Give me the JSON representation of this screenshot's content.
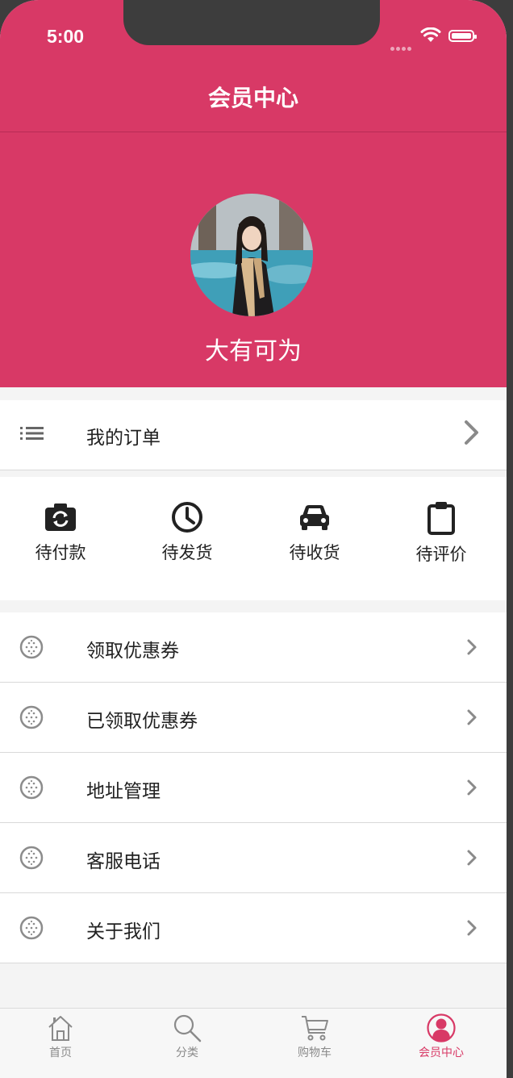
{
  "status_bar": {
    "time": "5:00"
  },
  "nav": {
    "title": "会员中心"
  },
  "profile": {
    "username": "大有可为"
  },
  "orders": {
    "label": "我的订单"
  },
  "order_statuses": [
    {
      "label": "待付款",
      "icon": "camera-icon"
    },
    {
      "label": "待发货",
      "icon": "clock-icon"
    },
    {
      "label": "待收货",
      "icon": "car-icon"
    },
    {
      "label": "待评价",
      "icon": "clipboard-icon"
    }
  ],
  "menu": [
    {
      "label": "领取优惠券"
    },
    {
      "label": "已领取优惠券"
    },
    {
      "label": "地址管理"
    },
    {
      "label": "客服电话"
    },
    {
      "label": "关于我们"
    }
  ],
  "tabbar": [
    {
      "label": "首页",
      "icon": "home-icon"
    },
    {
      "label": "分类",
      "icon": "search-icon"
    },
    {
      "label": "购物车",
      "icon": "cart-icon"
    },
    {
      "label": "会员中心",
      "icon": "member-icon",
      "active": true
    }
  ],
  "colors": {
    "accent": "#d83966",
    "inactive": "#8a8a8a"
  }
}
